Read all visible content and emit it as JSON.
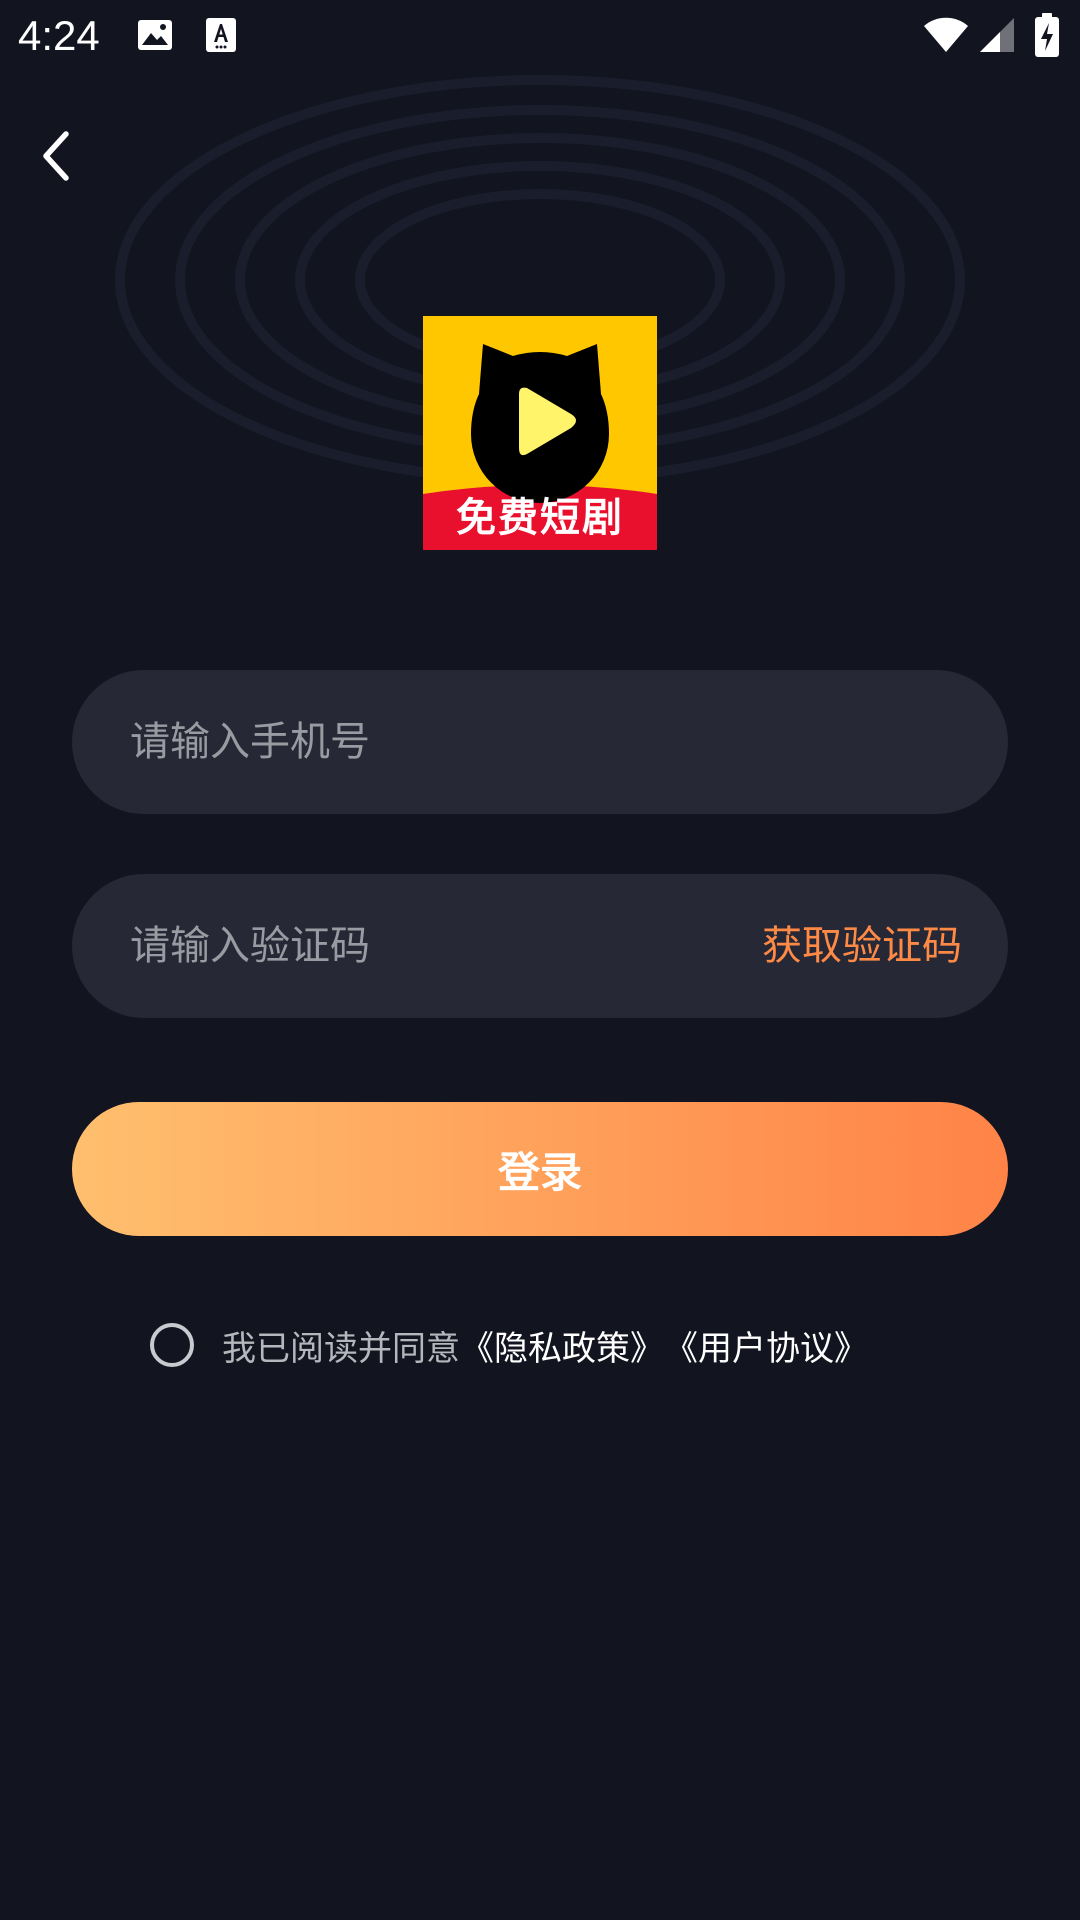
{
  "status_bar": {
    "time": "4:24"
  },
  "colors": {
    "background": "#121420",
    "input_background": "#262835",
    "accent": "#ff8a46",
    "logo_yellow": "#ffc700",
    "logo_red": "#e8102d"
  },
  "header": {
    "back_icon": "chevron-left-icon"
  },
  "logo": {
    "text": "免费短剧"
  },
  "form": {
    "phone_placeholder": "请输入手机号",
    "phone_value": "",
    "code_placeholder": "请输入验证码",
    "code_value": "",
    "get_code_label": "获取验证码",
    "login_label": "登录"
  },
  "agreement": {
    "checked": false,
    "prefix": "我已阅读并同意",
    "privacy_link": "《隐私政策》",
    "terms_link": "《用户协议》"
  }
}
